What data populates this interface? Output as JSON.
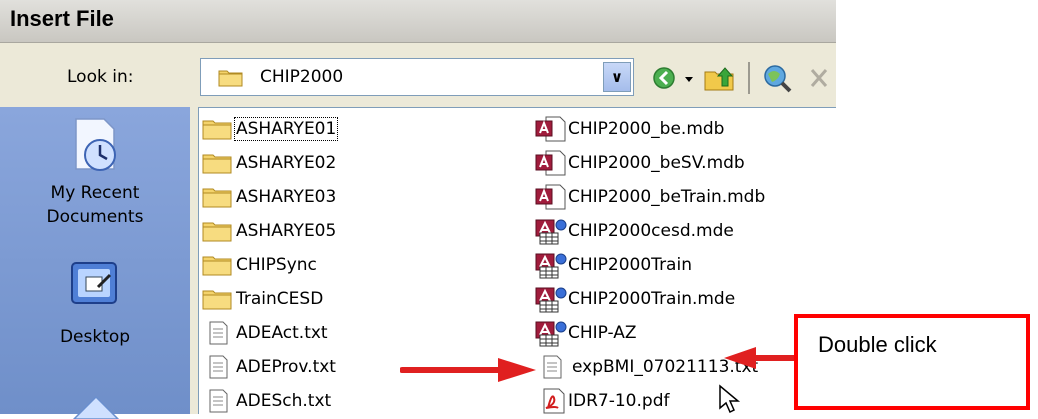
{
  "window": {
    "title": "Insert File"
  },
  "toolbar": {
    "look_in_label": "Look in:",
    "look_in_value": "CHIP2000"
  },
  "places": [
    {
      "label_line1": "My Recent",
      "label_line2": "Documents",
      "icon": "recent-documents-icon"
    },
    {
      "label_line1": "Desktop",
      "label_line2": "",
      "icon": "desktop-icon"
    }
  ],
  "files": {
    "left_column": [
      {
        "name": "ASHARYE01",
        "type": "folder"
      },
      {
        "name": "ASHARYE02",
        "type": "folder"
      },
      {
        "name": "ASHARYE03",
        "type": "folder"
      },
      {
        "name": "ASHARYE05",
        "type": "folder"
      },
      {
        "name": "CHIPSync",
        "type": "folder"
      },
      {
        "name": "TrainCESD",
        "type": "folder"
      },
      {
        "name": "ADEAct.txt",
        "type": "text"
      },
      {
        "name": "ADEProv.txt",
        "type": "text"
      },
      {
        "name": "ADESch.txt",
        "type": "text"
      }
    ],
    "right_column": [
      {
        "name": "CHIP2000_be.mdb",
        "type": "mdb"
      },
      {
        "name": "CHIP2000_beSV.mdb",
        "type": "mdb"
      },
      {
        "name": "CHIP2000_beTrain.mdb",
        "type": "mdb"
      },
      {
        "name": "CHIP2000cesd.mde",
        "type": "mde"
      },
      {
        "name": "CHIP2000Train",
        "type": "mde"
      },
      {
        "name": "CHIP2000Train.mde",
        "type": "mde"
      },
      {
        "name": "CHIP-AZ",
        "type": "mde"
      },
      {
        "name": "expBMI_07021113.txt",
        "type": "text"
      },
      {
        "name": "IDR7-10.pdf",
        "type": "pdf"
      }
    ]
  },
  "annotation": {
    "text": "Double click",
    "color": "#ff0000"
  }
}
